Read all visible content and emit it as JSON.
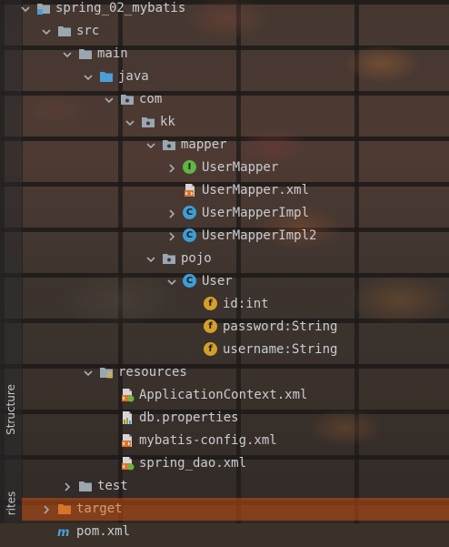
{
  "side_tabs": {
    "structure": "Structure",
    "favorites": "rites"
  },
  "tree": {
    "rows": [
      {
        "label": "spring_02_mybatis",
        "kind": "module",
        "depth": 0,
        "expanded": true
      },
      {
        "label": "src",
        "kind": "folder",
        "depth": 1,
        "expanded": true
      },
      {
        "label": "main",
        "kind": "folder",
        "depth": 2,
        "expanded": true
      },
      {
        "label": "java",
        "kind": "source-root",
        "depth": 3,
        "expanded": true
      },
      {
        "label": "com",
        "kind": "package",
        "depth": 4,
        "expanded": true
      },
      {
        "label": "kk",
        "kind": "package",
        "depth": 5,
        "expanded": true
      },
      {
        "label": "mapper",
        "kind": "package",
        "depth": 6,
        "expanded": true
      },
      {
        "label": "UserMapper",
        "kind": "interface",
        "depth": 7,
        "expanded": false
      },
      {
        "label": "UserMapper.xml",
        "kind": "xml-file",
        "depth": 7
      },
      {
        "label": "UserMapperImpl",
        "kind": "class",
        "depth": 7,
        "expanded": false
      },
      {
        "label": "UserMapperImpl2",
        "kind": "class",
        "depth": 7,
        "expanded": false
      },
      {
        "label": "pojo",
        "kind": "package",
        "depth": 6,
        "expanded": true
      },
      {
        "label": "User",
        "kind": "class",
        "depth": 7,
        "expanded": true
      },
      {
        "label": "id:int",
        "kind": "field",
        "depth": 8
      },
      {
        "label": "password:String",
        "kind": "field",
        "depth": 8
      },
      {
        "label": "username:String",
        "kind": "field",
        "depth": 8
      },
      {
        "label": "resources",
        "kind": "resources-root",
        "depth": 3,
        "expanded": true
      },
      {
        "label": "ApplicationContext.xml",
        "kind": "spring-xml",
        "depth": 4
      },
      {
        "label": "db.properties",
        "kind": "properties",
        "depth": 4
      },
      {
        "label": "mybatis-config.xml",
        "kind": "xml-file",
        "depth": 4
      },
      {
        "label": "spring_dao.xml",
        "kind": "spring-xml",
        "depth": 4
      },
      {
        "label": "test",
        "kind": "folder",
        "depth": 2,
        "expanded": false
      },
      {
        "label": "target",
        "kind": "excluded-folder",
        "depth": 1,
        "expanded": false,
        "selected": true
      },
      {
        "label": "pom.xml",
        "kind": "maven",
        "depth": 1
      }
    ]
  },
  "colors": {
    "text": "#c9ccd1",
    "selection": "#c85014",
    "class_icon": "#3d9ed6",
    "interface_icon": "#62b543",
    "field_icon": "#d59f2a",
    "folder": "#9aa7b0",
    "source_folder": "#4a9fd8",
    "excluded_folder": "#d8742a"
  }
}
